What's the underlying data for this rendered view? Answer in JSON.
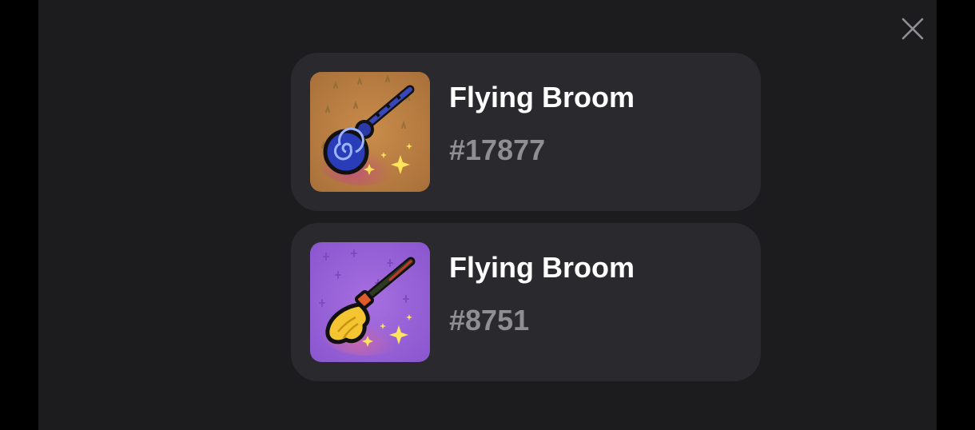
{
  "modal": {
    "close_icon": "close-icon",
    "close_color": "#8e8e93",
    "background_color": "#1c1c1e"
  },
  "items": [
    {
      "name": "Flying Broom",
      "id": "#17877",
      "thumbnail_icon": "blue-swirl-broom-icon",
      "thumbnail_bg": "#b8803f"
    },
    {
      "name": "Flying Broom",
      "id": "#8751",
      "thumbnail_icon": "yellow-broom-icon",
      "thumbnail_bg": "#9a63d8"
    }
  ]
}
